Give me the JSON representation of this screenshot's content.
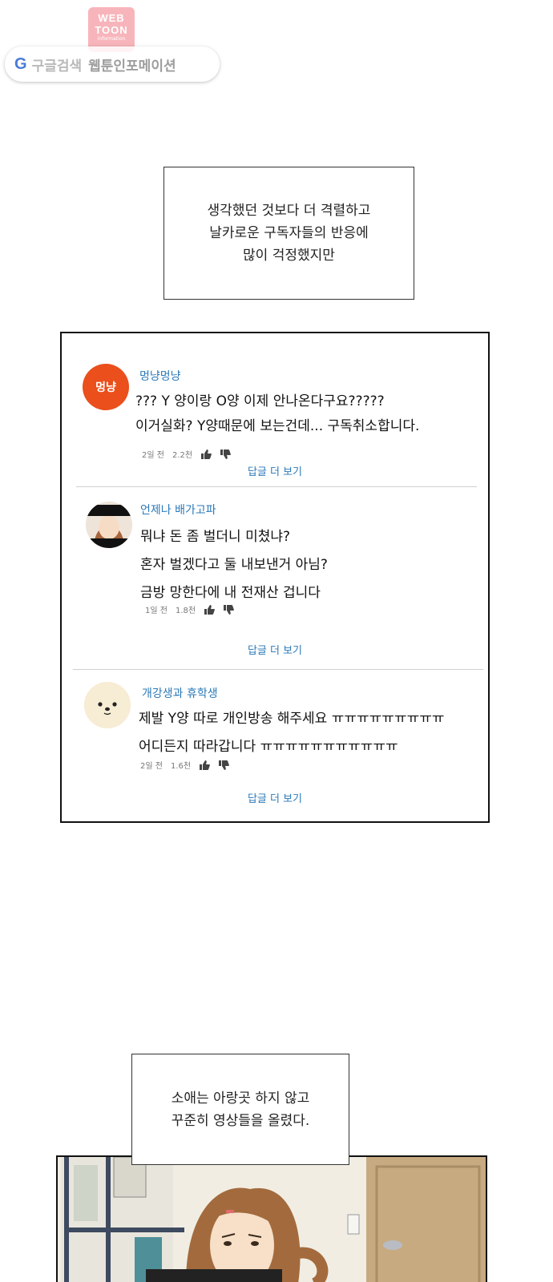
{
  "watermark": {
    "badge_line1": "WEB",
    "badge_line2": "TOON",
    "badge_line3": "information",
    "g_letter": "G",
    "search_text": "구글검색",
    "site_name": "웹툰인포메이션"
  },
  "narration_top": {
    "lines": [
      "생각했던 것보다 더 격렬하고",
      "날카로운 구독자들의 반응에",
      "많이 걱정했지만"
    ]
  },
  "comments": [
    {
      "avatar_text": "멍냥",
      "username": "멍냥멍냥",
      "lines": [
        "??? Y 양이랑 O양 이제 안나온다구요?????",
        "이거실화? Y양때문에 보는건데... 구독취소합니다."
      ],
      "age": "2일 전",
      "likes": "2.2천",
      "more": "답글 더 보기"
    },
    {
      "username": "언제나 배가고파",
      "lines": [
        "뭐냐 돈 좀 벌더니 미쳤냐?",
        "혼자 벌겠다고 둘 내보낸거 아님?",
        "금방 망한다에 내 전재산 겁니다"
      ],
      "age": "1일 전",
      "likes": "1.8천",
      "more": "답글 더 보기"
    },
    {
      "username": "개강생과 휴학생",
      "lines": [
        "제발 Y양 따로 개인방송 해주세요 ㅠㅠㅠㅠㅠㅠㅠㅠㅠ",
        "어디든지 따라갑니다 ㅠㅠㅠㅠㅠㅠㅠㅠㅠㅠㅠ"
      ],
      "age": "2일 전",
      "likes": "1.6천",
      "more": "답글 더 보기"
    }
  ],
  "narration_bottom": {
    "lines": [
      "소애는 아랑곳 하지 않고",
      "꾸준히 영상들을 올렸다."
    ]
  },
  "colors": {
    "link_blue": "#2b79b8",
    "avatar_orange": "#ea4f1c",
    "watermark_pink": "#f6a9b0"
  }
}
